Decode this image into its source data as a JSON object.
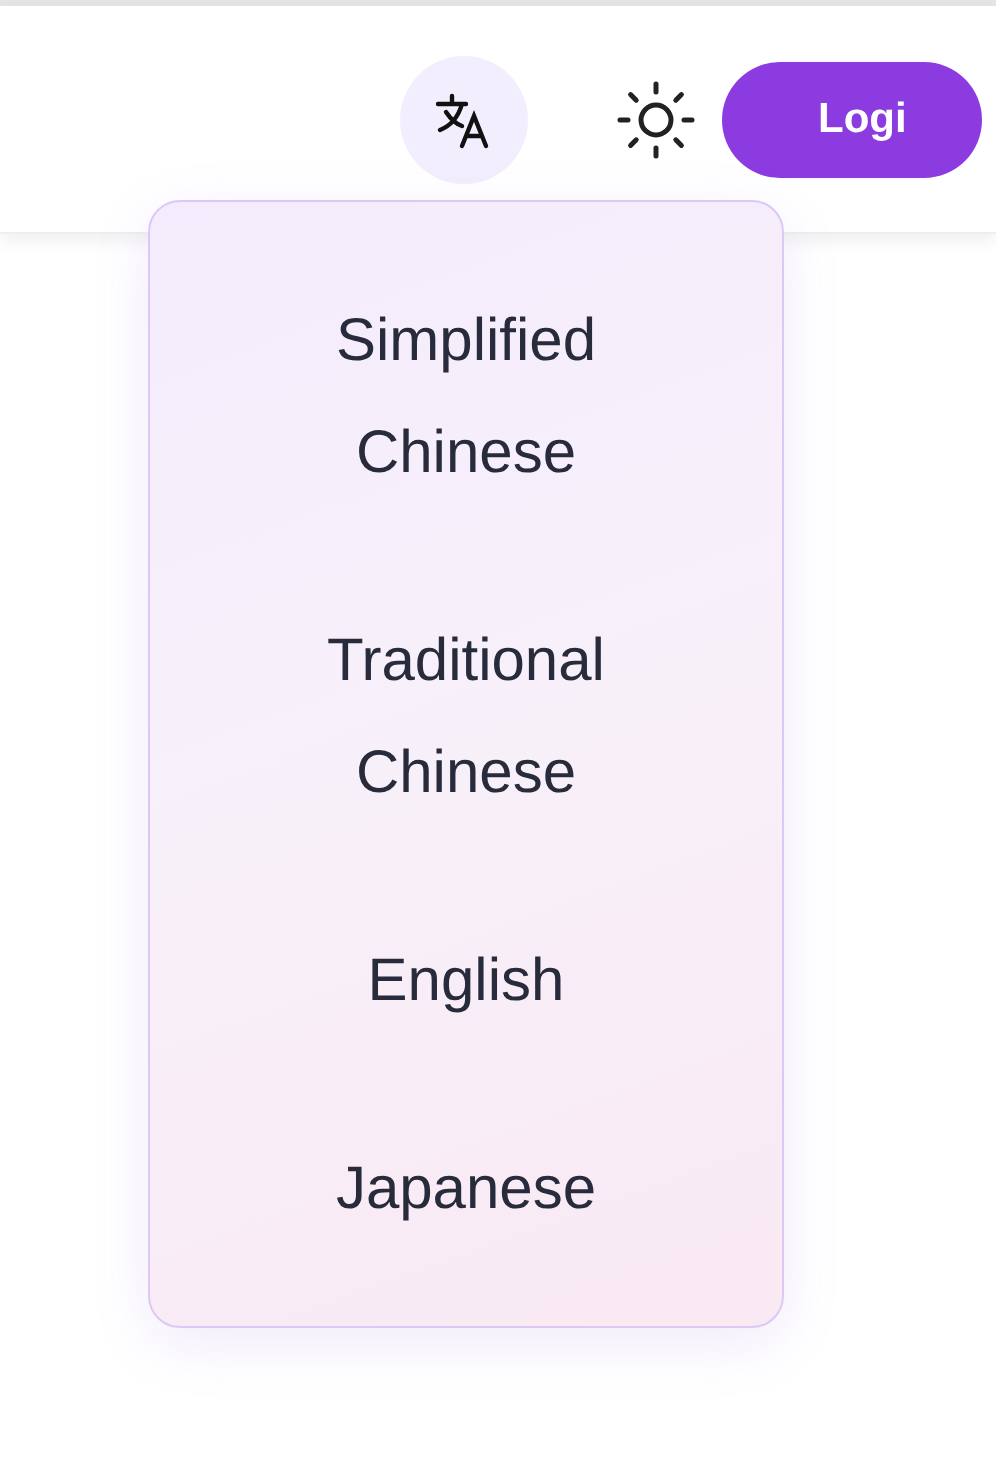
{
  "header": {
    "login_button": "Logi"
  },
  "language_menu": {
    "items": [
      {
        "label": "Simplified Chinese"
      },
      {
        "label": "Traditional Chinese"
      },
      {
        "label": "English"
      },
      {
        "label": "Japanese"
      }
    ]
  }
}
